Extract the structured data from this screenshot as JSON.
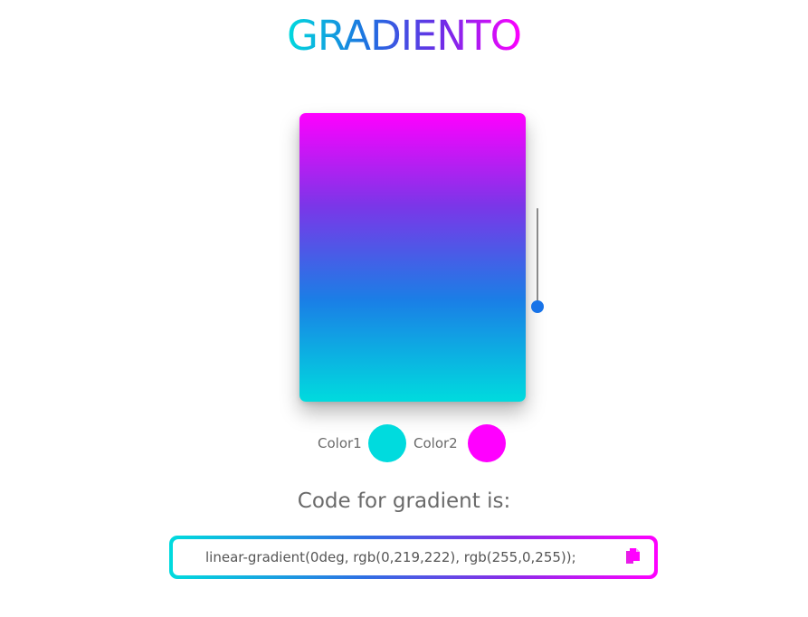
{
  "app": {
    "title": "GRADIENTO"
  },
  "gradient": {
    "angle_deg": 0,
    "color1": "#00dbde",
    "color2": "#ff00ff",
    "angle_slider_fraction": 0.97
  },
  "controls": {
    "color1_label": "Color1",
    "color2_label": "Color2"
  },
  "code": {
    "heading": "Code for gradient is:",
    "value": "linear-gradient(0deg, rgb(0,219,222), rgb(255,0,255));",
    "copy_icon": "copy-icon"
  }
}
